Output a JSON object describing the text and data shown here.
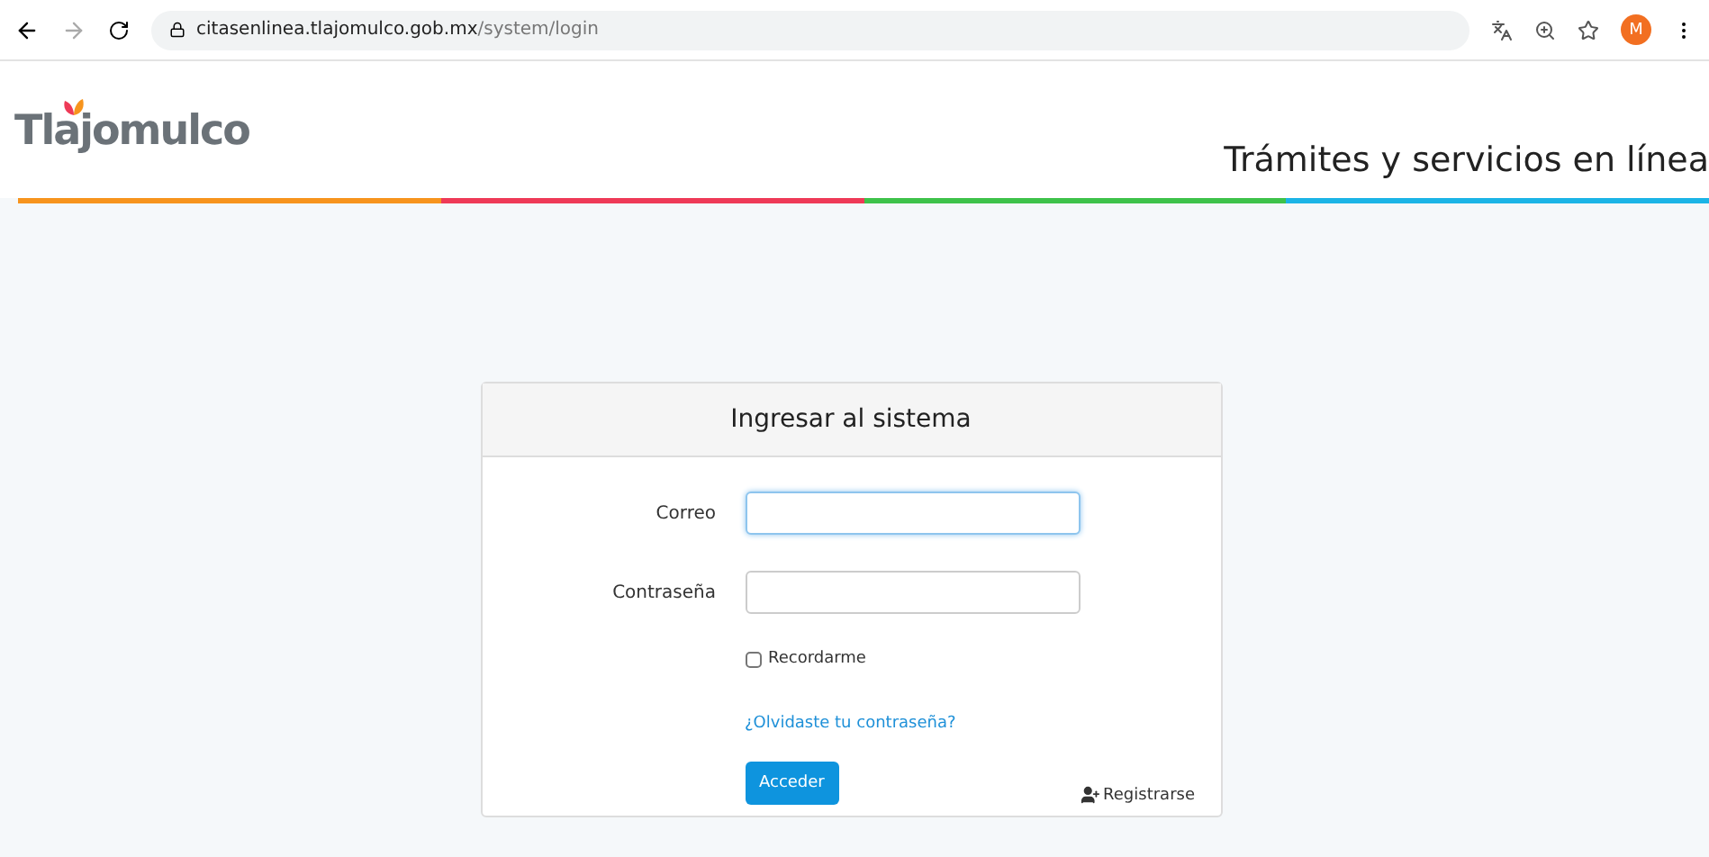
{
  "browser": {
    "url_host": "citasenlinea.tlajomulco.gob.mx",
    "url_path": "/system/login",
    "profile_initial": "M"
  },
  "header": {
    "logo": "Tlajomulco",
    "tagline": "Trámites y servicios en línea"
  },
  "login": {
    "title": "Ingresar al sistema",
    "fields": [
      {
        "label": "Correo",
        "focused": true
      },
      {
        "label": "Contraseña",
        "focused": false
      }
    ],
    "remember": {
      "label": "Recordarme",
      "checked": false
    },
    "forgot_link": "¿Olvidaste tu contraseña?",
    "submit": "Acceder",
    "register": "Registrarse"
  }
}
